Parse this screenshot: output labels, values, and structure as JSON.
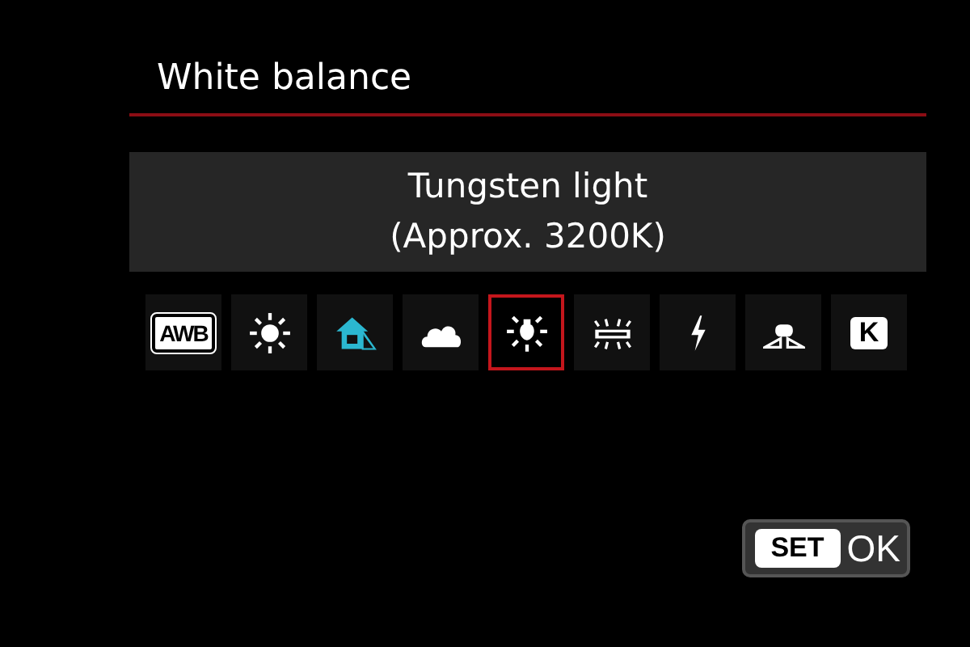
{
  "title": "White balance",
  "selection": {
    "lines": [
      "Tungsten light",
      "(Approx. 3200K)"
    ]
  },
  "presets": [
    {
      "kind": "awb",
      "label": "AWB",
      "selected": false
    },
    {
      "kind": "daylight",
      "selected": false
    },
    {
      "kind": "shade",
      "selected": false
    },
    {
      "kind": "cloudy",
      "selected": false
    },
    {
      "kind": "tungsten",
      "selected": true
    },
    {
      "kind": "fluorescent",
      "selected": false
    },
    {
      "kind": "flash",
      "selected": false
    },
    {
      "kind": "custom",
      "selected": false
    },
    {
      "kind": "kelvin",
      "label": "K",
      "selected": false
    }
  ],
  "confirm": {
    "key": "SET",
    "label": "OK"
  }
}
